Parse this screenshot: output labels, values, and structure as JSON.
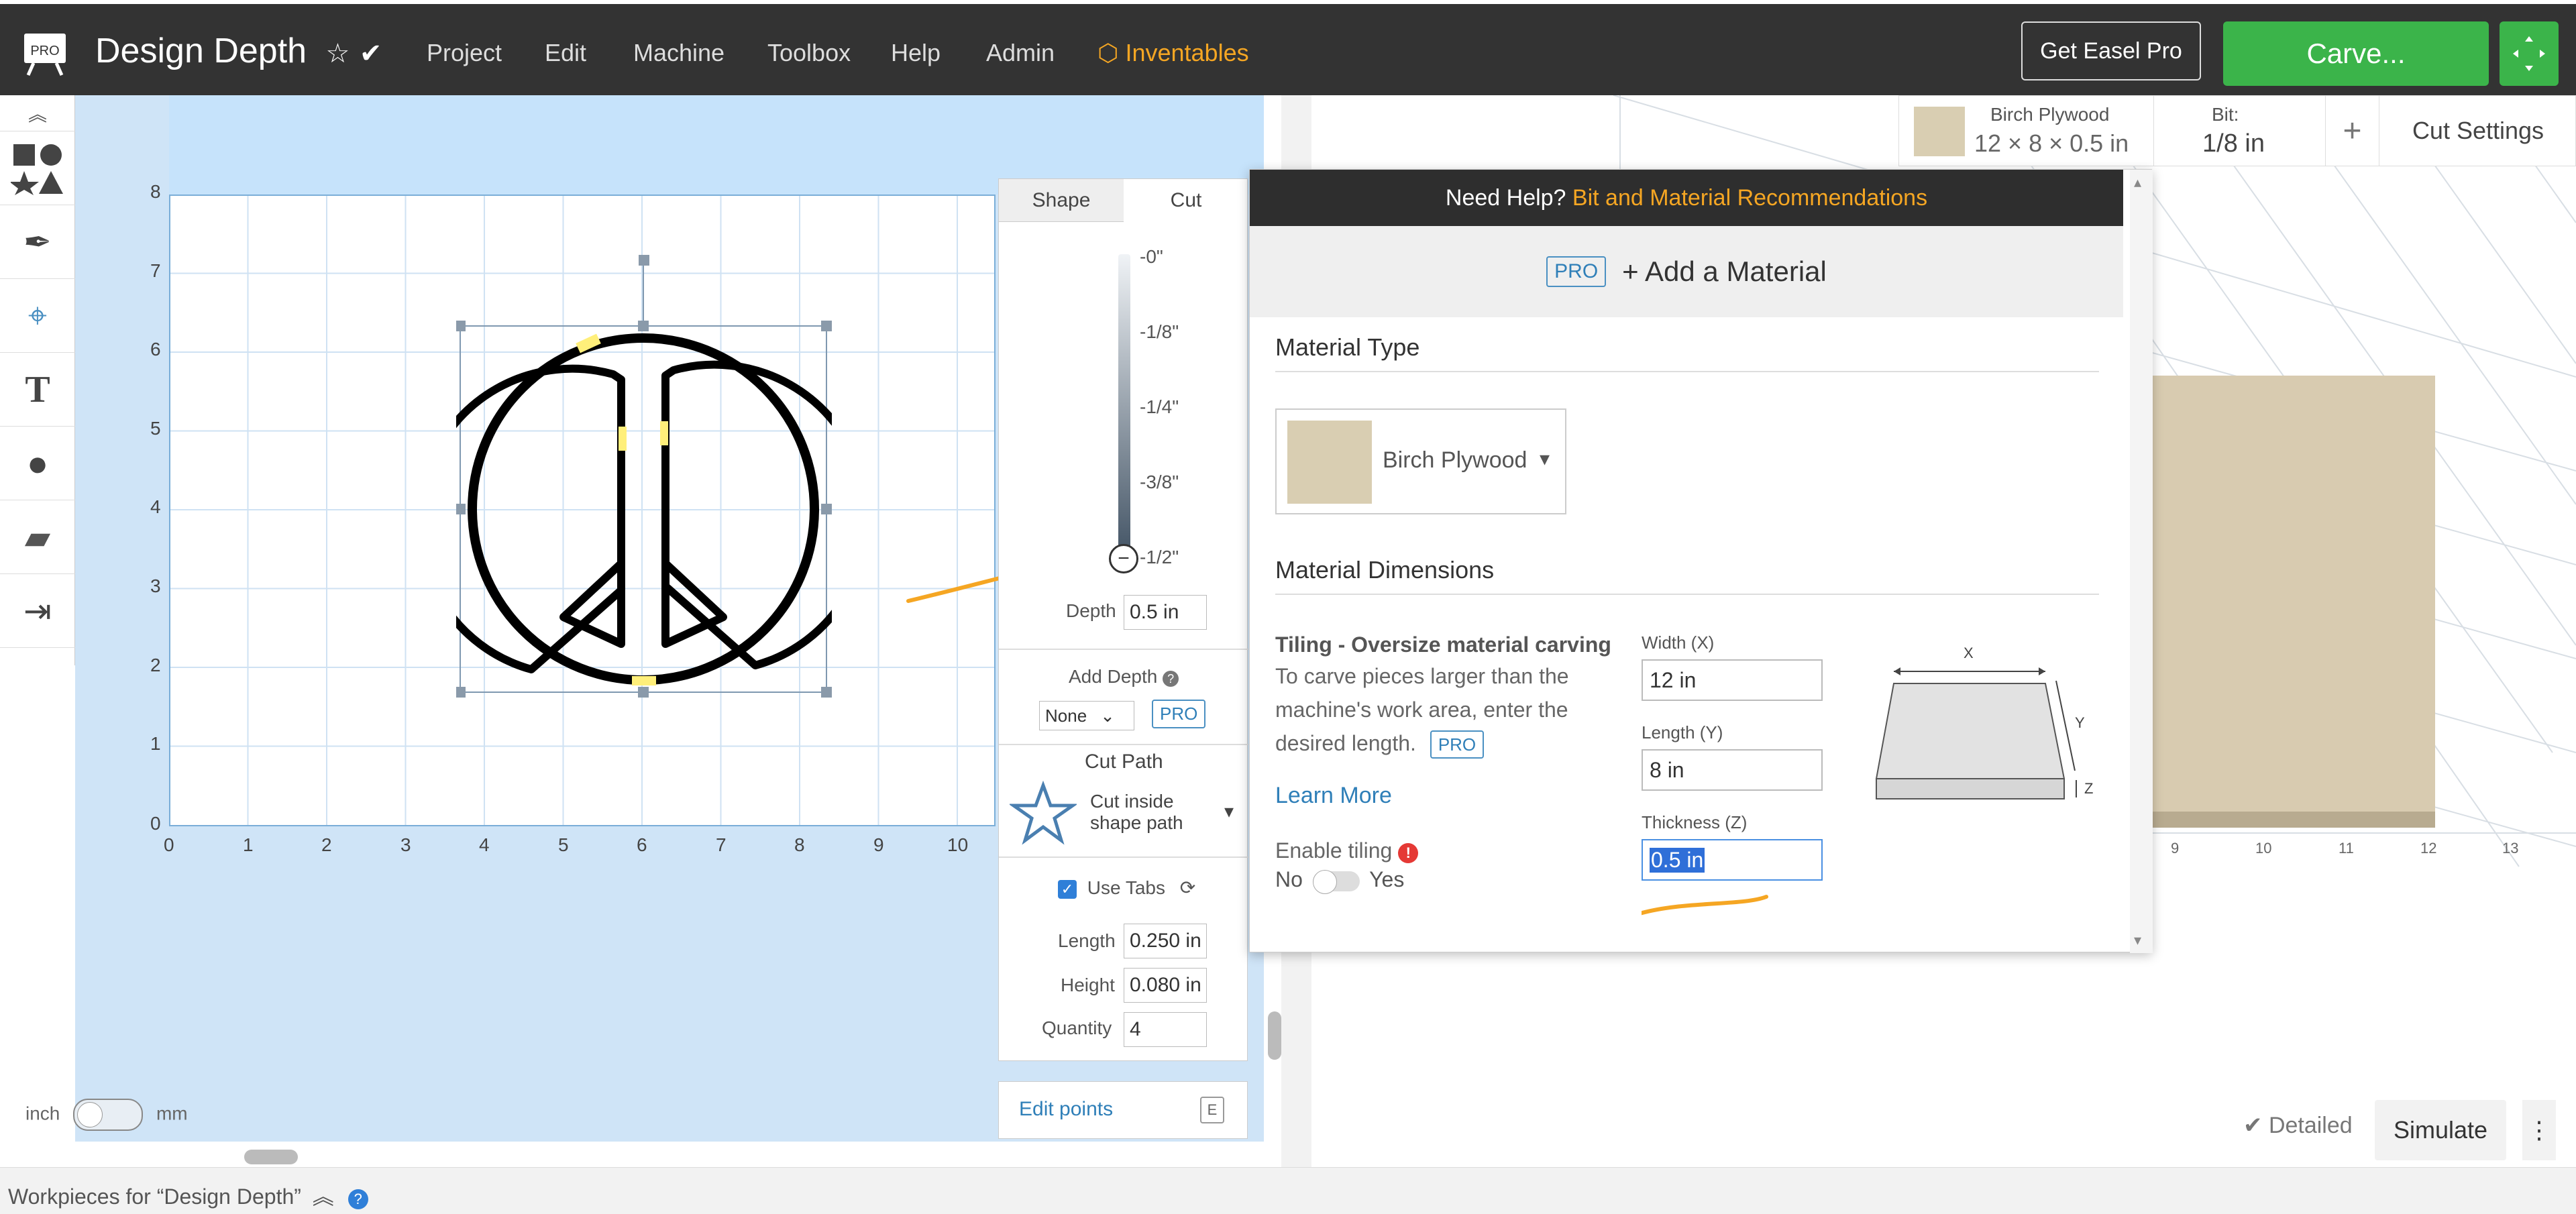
{
  "header": {
    "logo_badge": "PRO",
    "title": "Design Depth",
    "menu": [
      "Project",
      "Edit",
      "Machine",
      "Toolbox",
      "Help",
      "Admin"
    ],
    "brand": "Inventables",
    "get_pro": "Get Easel Pro",
    "carve": "Carve..."
  },
  "canvas": {
    "y_ticks": [
      "8",
      "7",
      "6",
      "5",
      "4",
      "3",
      "2",
      "1",
      "0"
    ],
    "x_ticks": [
      "0",
      "1",
      "2",
      "3",
      "4",
      "5",
      "6",
      "7",
      "8",
      "9",
      "10"
    ],
    "unit_left": "inch",
    "unit_right": "mm"
  },
  "props": {
    "tab_shape": "Shape",
    "tab_cut": "Cut",
    "depth_marks": [
      "-0\"",
      "-1/8\"",
      "-1/4\"",
      "-3/8\"",
      "-1/2\""
    ],
    "depth_label": "Depth",
    "depth_value": "0.5 in",
    "add_depth_label": "Add Depth",
    "add_depth_value": "None",
    "pro": "PRO",
    "cut_path_title": "Cut Path",
    "cut_path_value_1": "Cut inside",
    "cut_path_value_2": "shape path",
    "use_tabs": "Use Tabs",
    "length_label": "Length",
    "length_value": "0.250 in",
    "height_label": "Height",
    "height_value": "0.080 in",
    "quantity_label": "Quantity",
    "quantity_value": "4",
    "edit_points": "Edit points",
    "edit_key": "E"
  },
  "preview_toolbar": {
    "material_name": "Birch Plywood",
    "material_size": "12 × 8 × 0.5 in",
    "bit_label": "Bit:",
    "bit_value": "1/8 in",
    "plus": "+",
    "cut_settings": "Cut Settings",
    "ruler": [
      "9",
      "10",
      "11",
      "12",
      "13"
    ],
    "detailed": "Detailed",
    "simulate": "Simulate"
  },
  "modal": {
    "help_text": "Need Help?",
    "help_link": "Bit and Material Recommendations",
    "pro": "PRO",
    "add_material": "+ Add a Material",
    "material_type_title": "Material Type",
    "material_selected": "Birch Plywood",
    "dimensions_title": "Material Dimensions",
    "tiling_title": "Tiling - Oversize material carving",
    "tiling_desc_1": "To carve pieces larger than the",
    "tiling_desc_2": "machine's work area, enter the",
    "tiling_desc_3": "desired length.",
    "learn_more": "Learn More",
    "enable_tiling": "Enable tiling",
    "no": "No",
    "yes": "Yes",
    "width_label": "Width (X)",
    "width_value": "12 in",
    "length_label": "Length (Y)",
    "length_value": "8 in",
    "thickness_label": "Thickness (Z)",
    "thickness_value": "0.5 in",
    "diagram_x": "X",
    "diagram_y": "Y",
    "diagram_z": "Z"
  },
  "footer": {
    "workpieces": "Workpieces for “Design Depth”"
  },
  "colors": {
    "accent_green": "#3bb44a",
    "brand_orange": "#f5a623",
    "pro_blue": "#2f7fb8"
  }
}
